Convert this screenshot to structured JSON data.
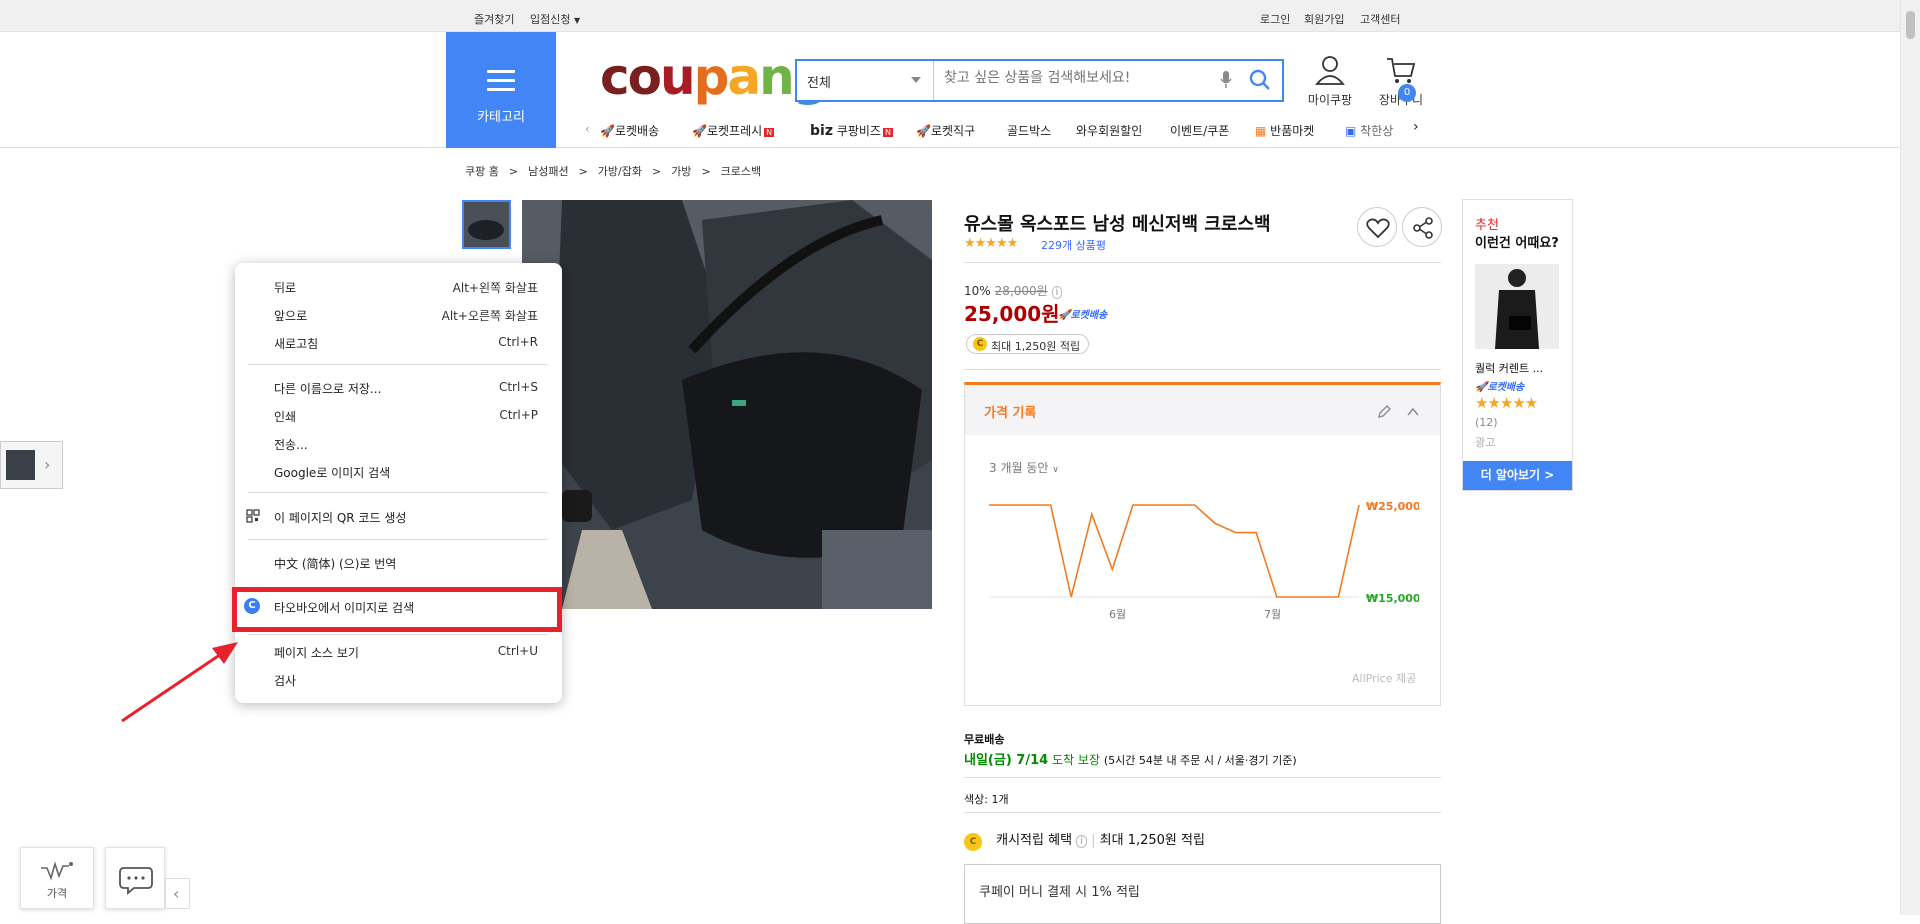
{
  "topbar": {
    "bookmark": "즐겨찾기",
    "seller_apply": "입점신청",
    "login": "로그인",
    "signup": "회원가입",
    "help": "고객센터"
  },
  "header": {
    "category_label": "카테고리",
    "logo": "coupang",
    "search_category": "전체",
    "search_placeholder": "찾고 싶은 상품을 검색해보세요!",
    "mycoupang": "마이쿠팡",
    "cart": "장바구니",
    "cart_count": "0",
    "accent": "#4285f4"
  },
  "nav": {
    "items": [
      "로켓배송",
      "로켓프레시",
      "쿠팡비즈",
      "로켓직구",
      "골드박스",
      "와우회원할인",
      "이벤트/쿠폰",
      "반품마켓",
      "착한상"
    ],
    "biz_prefix": "biz",
    "new_badge": "N"
  },
  "breadcrumb": [
    "쿠팡 홈",
    ">",
    "남성패션",
    ">",
    "가방/잡화",
    ">",
    "가방",
    ">",
    "크로스백"
  ],
  "product": {
    "title": "유스몰 옥스포드 남성 메신저백 크로스백",
    "rating": 4.5,
    "stars_text": "★★★★★",
    "reviews": "229개 상품평",
    "discount": "10%",
    "original_price": "28,000원",
    "price": "25,000원",
    "rocket": "로켓배송",
    "reward": "최대 1,250원 적립"
  },
  "price_history": {
    "title": "가격 기록",
    "range": "3 개월 동안",
    "credit": "AllPrice 제공"
  },
  "chart_data": {
    "type": "line",
    "xlabel": "",
    "ylabel": "",
    "x_ticks": [
      "6월",
      "7월"
    ],
    "y_ticks": [
      "₩25,000",
      "₩15,000"
    ],
    "ylim": [
      15000,
      25000
    ],
    "series": [
      {
        "values": [
          25000,
          25000,
          25000,
          25000,
          15000,
          24000,
          18000,
          25000,
          25000,
          25000,
          25000,
          23000,
          22000,
          22000,
          15000,
          15000,
          15000,
          15000,
          25000
        ]
      }
    ]
  },
  "shipping": {
    "label": "무료배송",
    "arrival": "내일(금) 7/14",
    "guarantee": "도착 보장",
    "detail": "(5시간 54분  내 주문 시 / 서울⋅경기 기준)"
  },
  "color_option": "색상: 1개",
  "cash": {
    "label": "캐시적립 혜택",
    "detail": "최대 1,250원 적립"
  },
  "coupay": "쿠페이 머니 결제 시 1% 적립",
  "recommend": {
    "tag": "추천",
    "title": "이런건 어때요?",
    "name": "퀄럭 커렌트 ...",
    "rocket": "로켓배송",
    "stars": "★★★★★",
    "count": "(12)",
    "ad": "광고",
    "more": "더 알아보기 >"
  },
  "floating": {
    "price_label": "가격"
  },
  "context_menu": {
    "items": [
      {
        "label": "뒤로",
        "shortcut": "Alt+왼쪽 화살표"
      },
      {
        "label": "앞으로",
        "shortcut": "Alt+오른쪽 화살표"
      },
      {
        "label": "새로고침",
        "shortcut": "Ctrl+R"
      },
      {
        "label": "다른 이름으로 저장...",
        "shortcut": "Ctrl+S"
      },
      {
        "label": "인쇄",
        "shortcut": "Ctrl+P"
      },
      {
        "label": "전송...",
        "shortcut": ""
      },
      {
        "label": "Google로 이미지 검색",
        "shortcut": ""
      },
      {
        "label": "이 페이지의 QR 코드 생성",
        "shortcut": ""
      },
      {
        "label": "中文 (简体) (으)로 번역",
        "shortcut": ""
      },
      {
        "label": "타오바오에서 이미지로 검색",
        "shortcut": ""
      },
      {
        "label": "페이지 소스 보기",
        "shortcut": "Ctrl+U"
      },
      {
        "label": "검사",
        "shortcut": ""
      }
    ],
    "highlight_color": "#e8222d"
  }
}
